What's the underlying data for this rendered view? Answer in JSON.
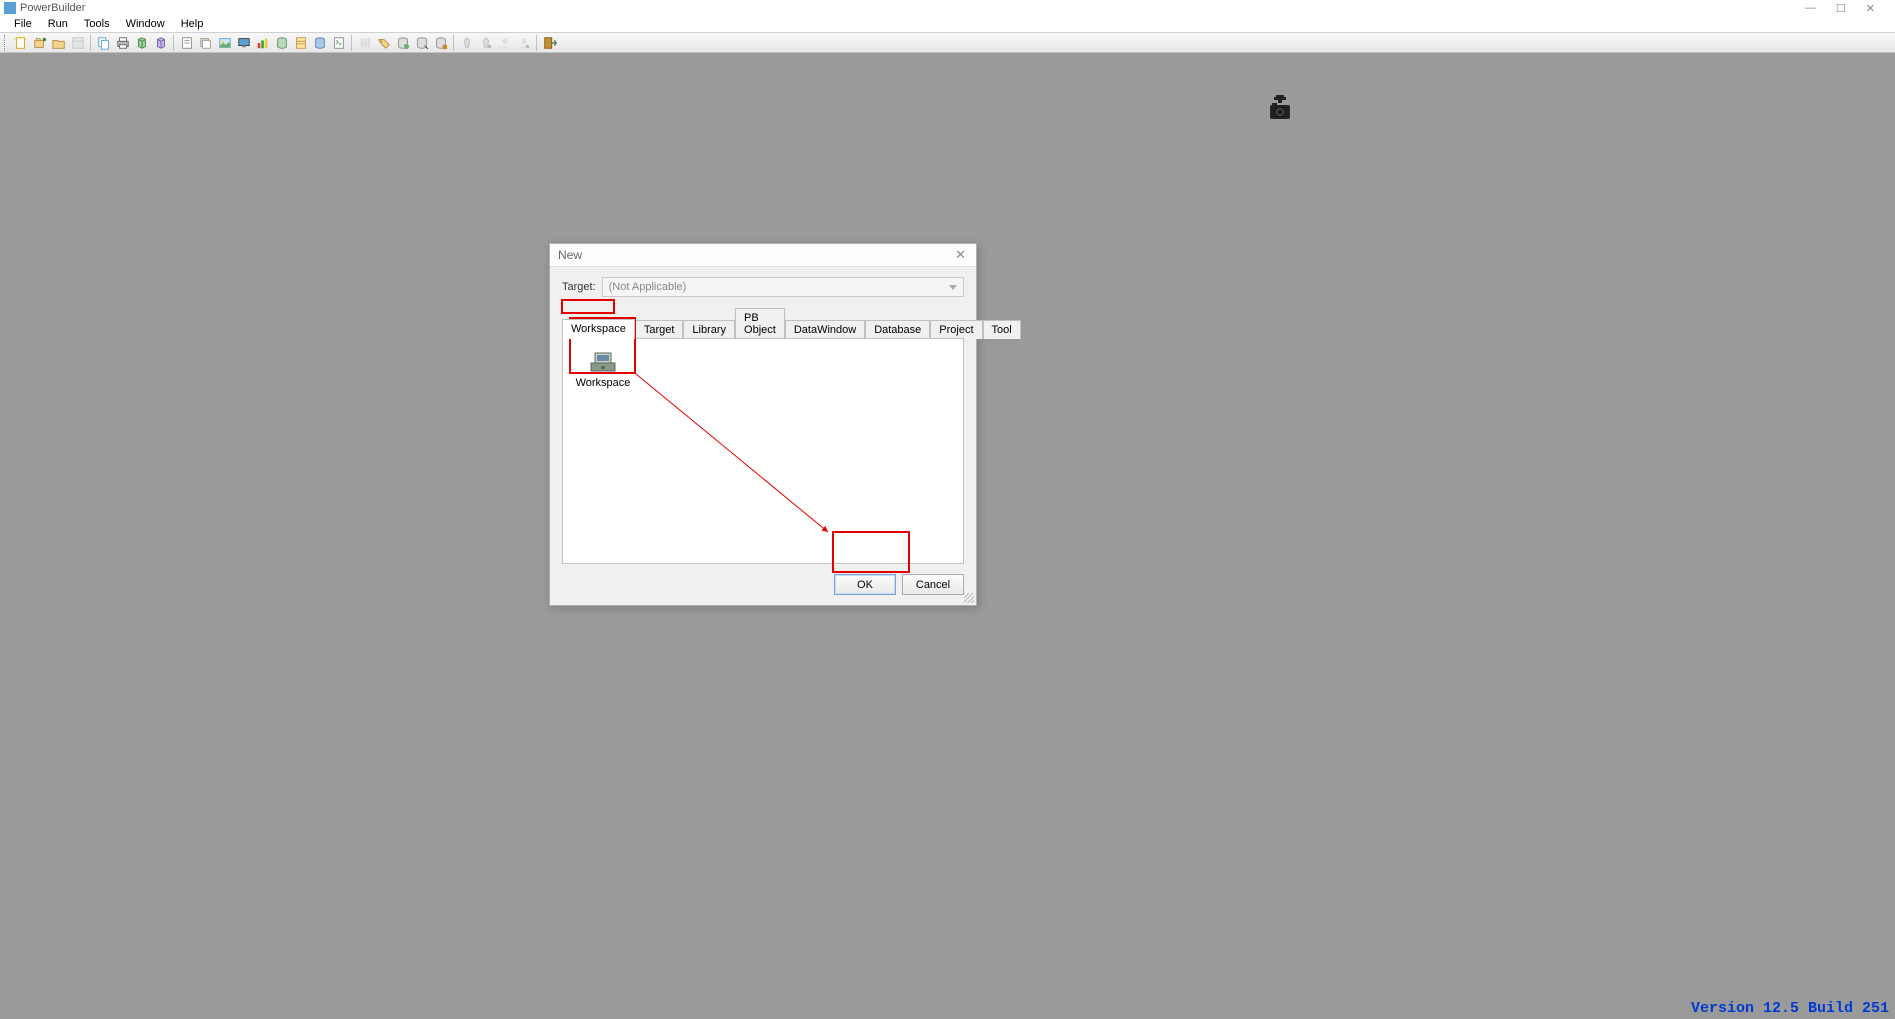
{
  "app": {
    "title": "PowerBuilder"
  },
  "menu": {
    "items": [
      "File",
      "Run",
      "Tools",
      "Window",
      "Help"
    ]
  },
  "toolbar": {
    "buttons": [
      "new-button",
      "open-button",
      "open-folder-button",
      "properties-button",
      "sep",
      "copy-button",
      "print-button",
      "3d-button",
      "3d-alt-button",
      "sep",
      "note-button",
      "stack-button",
      "picture-button",
      "monitor-button",
      "chart-button",
      "db-table-button",
      "dw-button",
      "cylinder-button",
      "script-button",
      "sep",
      "library-button",
      "tag-button",
      "db-profile-button",
      "query-button",
      "db-painter-button",
      "sep",
      "debug-button",
      "debug-step-button",
      "run-button",
      "run-alt-button",
      "sep",
      "exit-button"
    ]
  },
  "dialog": {
    "title": "New",
    "target_label": "Target:",
    "target_value": "(Not Applicable)",
    "tabs": [
      "Workspace",
      "Target",
      "Library",
      "PB Object",
      "DataWindow",
      "Database",
      "Project",
      "Tool"
    ],
    "active_tab": 0,
    "item_label": "Workspace",
    "ok": "OK",
    "cancel": "Cancel"
  },
  "footer": {
    "version": "Version 12.5 Build 251"
  }
}
